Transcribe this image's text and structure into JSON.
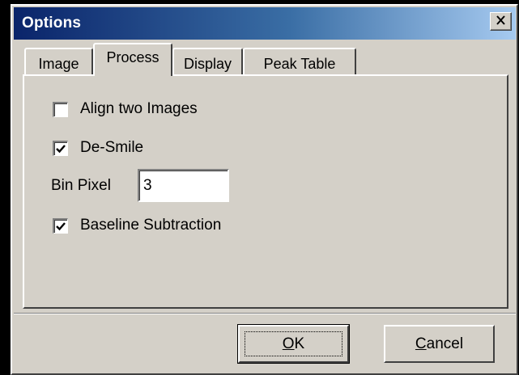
{
  "window": {
    "title": "Options",
    "close_glyph": "×"
  },
  "tabs": [
    {
      "label": "Image",
      "active": false
    },
    {
      "label": "Process",
      "active": true
    },
    {
      "label": "Display",
      "active": false
    },
    {
      "label": "Peak Table",
      "active": false
    }
  ],
  "process": {
    "align_two_images": {
      "label": "Align two Images",
      "checked": false
    },
    "de_smile": {
      "label": "De-Smile",
      "checked": true
    },
    "bin_pixel": {
      "label": "Bin Pixel",
      "value": "3"
    },
    "baseline_subtraction": {
      "label": "Baseline Subtraction",
      "checked": true
    }
  },
  "buttons": {
    "ok": {
      "mnemonic": "O",
      "rest": "K"
    },
    "cancel": {
      "mnemonic": "C",
      "rest": "ancel"
    }
  },
  "colors": {
    "face": "#d4d0c8",
    "titlebar_start": "#0a246a",
    "titlebar_end": "#a6caf0"
  }
}
